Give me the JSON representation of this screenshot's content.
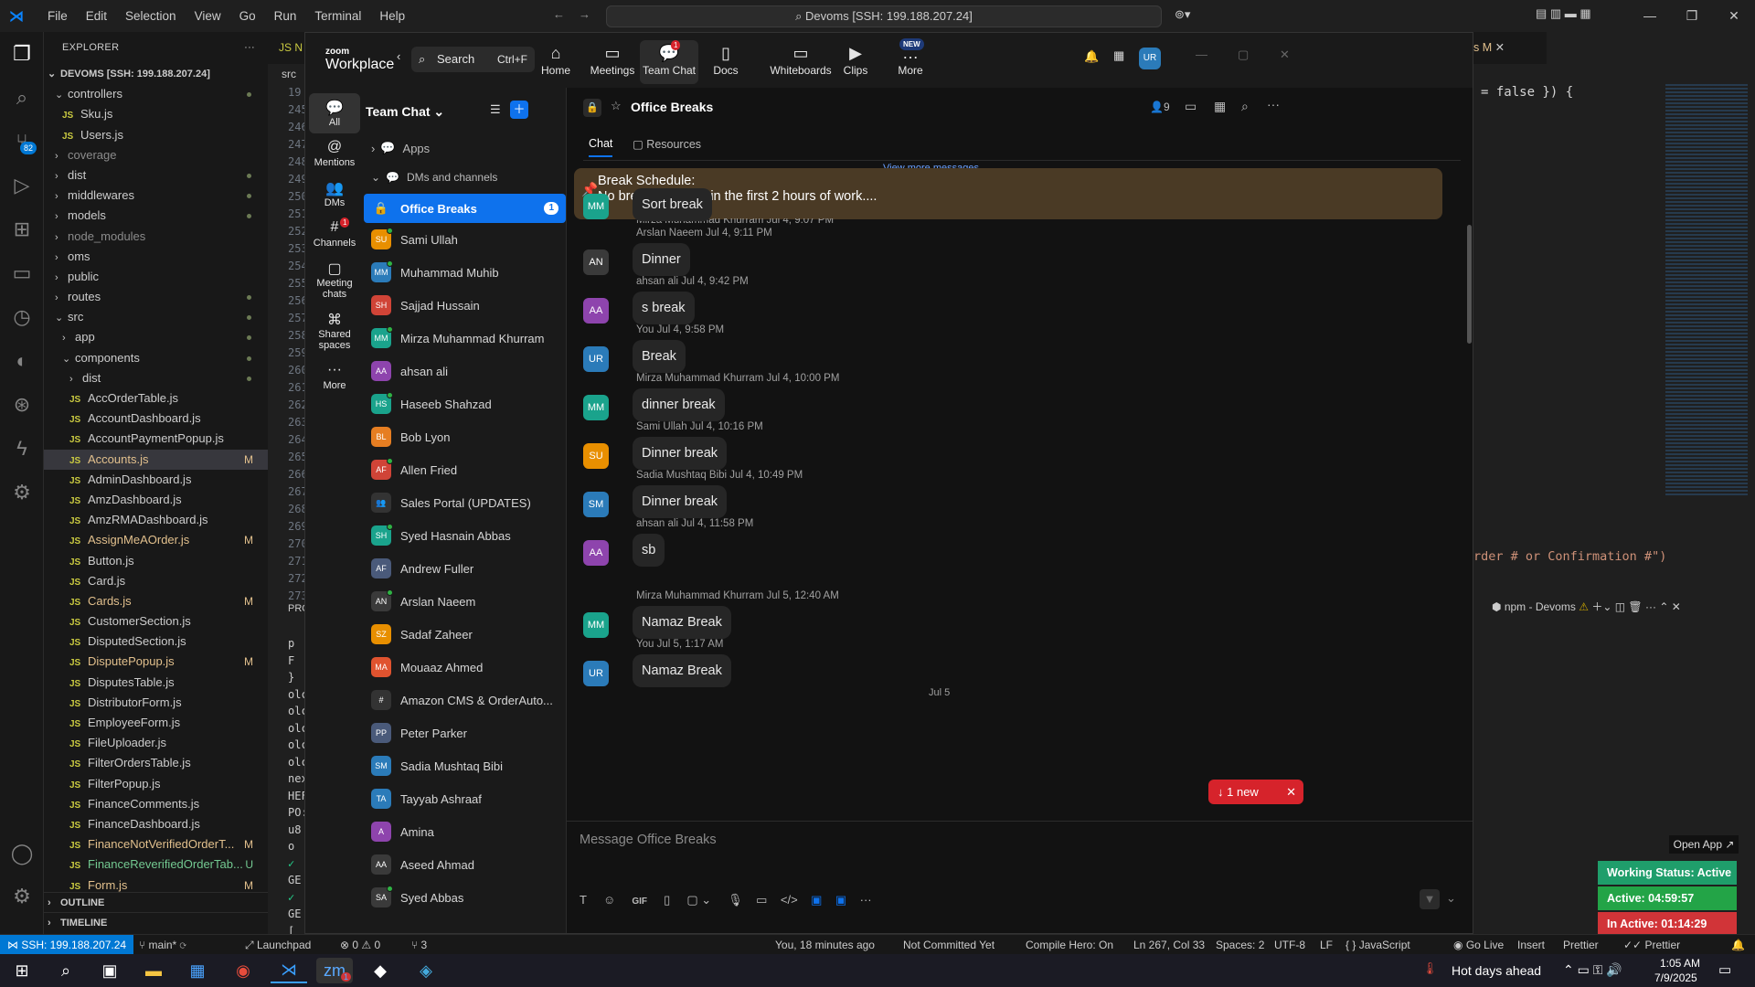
{
  "vscode": {
    "menu": [
      "File",
      "Edit",
      "Selection",
      "View",
      "Go",
      "Run",
      "Terminal",
      "Help"
    ],
    "search": "Devoms [SSH: 199.188.207.24]",
    "explorer_title": "EXPLORER",
    "root": "DEVOMS [SSH: 199.188.207.24]",
    "source_control_badge": "82",
    "tree": [
      {
        "label": "controllers",
        "type": "folder-open",
        "depth": 1,
        "dot": true
      },
      {
        "label": "Sku.js",
        "type": "js",
        "depth": 2
      },
      {
        "label": "Users.js",
        "type": "js",
        "depth": 2
      },
      {
        "label": "coverage",
        "type": "folder",
        "depth": 1,
        "dim": true
      },
      {
        "label": "dist",
        "type": "folder",
        "depth": 1,
        "dot": true
      },
      {
        "label": "middlewares",
        "type": "folder",
        "depth": 1,
        "dot": true
      },
      {
        "label": "models",
        "type": "folder",
        "depth": 1,
        "dot": true
      },
      {
        "label": "node_modules",
        "type": "folder",
        "depth": 1,
        "dim": true
      },
      {
        "label": "oms",
        "type": "folder",
        "depth": 1
      },
      {
        "label": "public",
        "type": "folder",
        "depth": 1
      },
      {
        "label": "routes",
        "type": "folder",
        "depth": 1,
        "dot": true
      },
      {
        "label": "src",
        "type": "folder-open",
        "depth": 1,
        "dot": true
      },
      {
        "label": "app",
        "type": "folder",
        "depth": 2,
        "dot": true
      },
      {
        "label": "components",
        "type": "folder-open",
        "depth": 2,
        "dot": true
      },
      {
        "label": "dist",
        "type": "folder",
        "depth": 3,
        "dot": true
      },
      {
        "label": "AccOrderTable.js",
        "type": "js",
        "depth": 3
      },
      {
        "label": "AccountDashboard.js",
        "type": "js",
        "depth": 3
      },
      {
        "label": "AccountPaymentPopup.js",
        "type": "js",
        "depth": 3
      },
      {
        "label": "Accounts.js",
        "type": "js",
        "depth": 3,
        "mark": "M",
        "selected": true
      },
      {
        "label": "AdminDashboard.js",
        "type": "js",
        "depth": 3
      },
      {
        "label": "AmzDashboard.js",
        "type": "js",
        "depth": 3
      },
      {
        "label": "AmzRMADashboard.js",
        "type": "js",
        "depth": 3
      },
      {
        "label": "AssignMeAOrder.js",
        "type": "js",
        "depth": 3,
        "mark": "M"
      },
      {
        "label": "Button.js",
        "type": "js",
        "depth": 3
      },
      {
        "label": "Card.js",
        "type": "js",
        "depth": 3
      },
      {
        "label": "Cards.js",
        "type": "js",
        "depth": 3,
        "mark": "M"
      },
      {
        "label": "CustomerSection.js",
        "type": "js",
        "depth": 3
      },
      {
        "label": "DisputedSection.js",
        "type": "js",
        "depth": 3
      },
      {
        "label": "DisputePopup.js",
        "type": "js",
        "depth": 3,
        "mark": "M"
      },
      {
        "label": "DisputesTable.js",
        "type": "js",
        "depth": 3
      },
      {
        "label": "DistributorForm.js",
        "type": "js",
        "depth": 3
      },
      {
        "label": "EmployeeForm.js",
        "type": "js",
        "depth": 3
      },
      {
        "label": "FileUploader.js",
        "type": "js",
        "depth": 3
      },
      {
        "label": "FilterOrdersTable.js",
        "type": "js",
        "depth": 3
      },
      {
        "label": "FilterPopup.js",
        "type": "js",
        "depth": 3
      },
      {
        "label": "FinanceComments.js",
        "type": "js",
        "depth": 3
      },
      {
        "label": "FinanceDashboard.js",
        "type": "js",
        "depth": 3
      },
      {
        "label": "FinanceNotVerifiedOrderT...",
        "type": "js",
        "depth": 3,
        "mark": "M"
      },
      {
        "label": "FinanceReverifiedOrderTab...",
        "type": "js",
        "depth": 3,
        "mark": "U"
      },
      {
        "label": "Form.js",
        "type": "js",
        "depth": 3,
        "mark": "M"
      }
    ],
    "outline": "OUTLINE",
    "timeline": "TIMELINE",
    "editor_tab_label": "JS N",
    "editor_crumb": "src",
    "line_numbers": [
      "19",
      "245",
      "246",
      "247",
      "248",
      "249",
      "250",
      "251",
      "252",
      "253",
      "254",
      "255",
      "256",
      "257",
      "258",
      "259",
      "260",
      "261",
      "262",
      "263",
      "264",
      "265",
      "266",
      "267",
      "268",
      "269",
      "270",
      "271",
      "272",
      "273"
    ],
    "panel_label": "PRO",
    "terminal_lines": [
      "p",
      "F",
      "}",
      "olc",
      "olc",
      "olc",
      "olc",
      "olc",
      "nex",
      "HEF",
      "PO:",
      "u8",
      "o",
      "✓",
      "GE",
      "✓",
      "GE",
      "[",
      "["
    ],
    "right_tab": "s M",
    "code_snip": "= false }) {",
    "code_snip2": "rder # or Confirmation #\")",
    "terminal_name": "npm - Devoms"
  },
  "status": {
    "ssh": "SSH: 199.188.207.24",
    "branch": "main*",
    "launchpad": "Launchpad",
    "problems": "0 ⚠ 0",
    "ports": "3",
    "blame": "You, 18 minutes ago",
    "commit": "Not Committed Yet",
    "hero": "Compile Hero: On",
    "pos": "Ln 267, Col 33",
    "spaces": "Spaces: 2",
    "enc": "UTF-8",
    "eol": "LF",
    "lang": "JavaScript",
    "golive": "Go Live",
    "insert": "Insert",
    "prettier": "Prettier",
    "prettier2": "Prettier"
  },
  "taskbar": {
    "weather": "Hot days ahead",
    "time": "1:05 AM",
    "date": "7/9/2025",
    "zoom_badge": "1"
  },
  "overlay": {
    "open_app": "Open App",
    "working": "Working Status: Active",
    "active": "Active: 04:59:57",
    "inactive": "In Active: 01:14:29",
    "colors": {
      "working": "#1f9e6b",
      "active": "#23a447",
      "inactive": "#d13438"
    }
  },
  "zoom": {
    "brand_top": "zoom",
    "brand": "Workplace",
    "search": "Search",
    "search_shortcut": "Ctrl+F",
    "nav": [
      {
        "label": "Home",
        "icon": "home-icon",
        "glyph": "⌂"
      },
      {
        "label": "Meetings",
        "icon": "video-icon",
        "glyph": "▭"
      },
      {
        "label": "Team Chat",
        "icon": "chat-icon",
        "glyph": "💬",
        "active": true,
        "badge": "1"
      },
      {
        "label": "Docs",
        "icon": "doc-icon",
        "glyph": "▯"
      },
      {
        "label": "Whiteboards",
        "icon": "whiteboard-icon",
        "glyph": "▭"
      },
      {
        "label": "Clips",
        "icon": "clips-icon",
        "glyph": "▶"
      },
      {
        "label": "More",
        "icon": "more-icon",
        "glyph": "…",
        "tag": "NEW"
      }
    ],
    "avatar": "UR",
    "left": [
      {
        "label": "All",
        "glyph": "💬",
        "active": true
      },
      {
        "label": "Mentions",
        "glyph": "@"
      },
      {
        "label": "DMs",
        "glyph": "👥"
      },
      {
        "label": "Channels",
        "glyph": "#",
        "badge": "1"
      },
      {
        "label": "Meeting chats",
        "glyph": "▢"
      },
      {
        "label": "Shared spaces",
        "glyph": "⌘"
      },
      {
        "label": "More",
        "glyph": "···"
      }
    ],
    "list_title": "Team Chat",
    "apps": "Apps",
    "dms_channels": "DMs and channels",
    "selected": "Office Breaks",
    "selected_badge": "1",
    "contacts": [
      {
        "name": "Sami Ullah",
        "initials": "SU",
        "color": "#e88f00",
        "online": true
      },
      {
        "name": "Muhammad Muhib",
        "initials": "MM",
        "color": "#2b7bb9",
        "online": true
      },
      {
        "name": "Sajjad Hussain",
        "initials": "SH",
        "color": "#d04437"
      },
      {
        "name": "Mirza Muhammad Khurram",
        "initials": "MM",
        "color": "#1aa38c",
        "online": true
      },
      {
        "name": "ahsan ali",
        "initials": "AA",
        "color": "#8e44ad"
      },
      {
        "name": "Haseeb Shahzad",
        "initials": "HS",
        "color": "#1aa38c",
        "online": true
      },
      {
        "name": "Bob Lyon",
        "initials": "BL",
        "color": "#e67e22"
      },
      {
        "name": "Allen Fried",
        "initials": "AF",
        "color": "#d04437",
        "online": true
      },
      {
        "name": "Sales Portal (UPDATES)",
        "initials": "👥",
        "color": "#333333"
      },
      {
        "name": "Syed Hasnain Abbas",
        "initials": "SH",
        "color": "#1aa38c",
        "online": true
      },
      {
        "name": "Andrew Fuller",
        "initials": "AF",
        "color": "#4a5a7a"
      },
      {
        "name": "Arslan Naeem",
        "initials": "AN",
        "color": "#3a3a3a",
        "online": true
      },
      {
        "name": "Sadaf Zaheer",
        "initials": "SZ",
        "color": "#e88f00"
      },
      {
        "name": "Mouaaz Ahmed",
        "initials": "MA",
        "color": "#e0532f"
      },
      {
        "name": "Amazon CMS & OrderAuto...",
        "initials": "#",
        "color": "#333333"
      },
      {
        "name": "Peter Parker",
        "initials": "PP",
        "color": "#4a5a7a"
      },
      {
        "name": "Sadia Mushtaq Bibi",
        "initials": "SM",
        "color": "#2b7bb9"
      },
      {
        "name": "Tayyab Ashraaf",
        "initials": "TA",
        "color": "#2b7bb9"
      },
      {
        "name": "Amina",
        "initials": "A",
        "color": "#8e44ad"
      },
      {
        "name": "Aseed Ahmad",
        "initials": "AA",
        "color": "#3a3a3a"
      },
      {
        "name": "Syed Abbas",
        "initials": "SA",
        "color": "#3a3a3a",
        "online": true
      }
    ],
    "channel": "Office Breaks",
    "members": "9",
    "tabs": [
      "Chat",
      "Resources"
    ],
    "pinned_title": "Break Schedule:",
    "pinned_body": "No breaks allowed in the first 2 hours of work....",
    "view_more": "View more messages",
    "partial_meta": "Mirza Muhammad Khurram Jul 4, 9:07 PM",
    "messages": [
      {
        "initials": "MM",
        "color": "#1aa38c",
        "meta": "",
        "text": "Sort break"
      },
      {
        "initials": "AN",
        "color": "#3a3a3a",
        "meta": "Arslan Naeem Jul 4, 9:11 PM",
        "text": "Dinner"
      },
      {
        "initials": "AA",
        "color": "#8e44ad",
        "meta": "ahsan ali Jul 4, 9:42 PM",
        "text": "s break"
      },
      {
        "initials": "UR",
        "color": "#2b7bb9",
        "meta": "You Jul 4, 9:58 PM",
        "text": "Break"
      },
      {
        "initials": "MM",
        "color": "#1aa38c",
        "meta": "Mirza Muhammad Khurram Jul 4, 10:00 PM",
        "text": "dinner break"
      },
      {
        "initials": "SU",
        "color": "#e88f00",
        "meta": "Sami Ullah Jul 4, 10:16 PM",
        "text": "Dinner break"
      },
      {
        "initials": "SM",
        "color": "#2b7bb9",
        "meta": "Sadia Mushtaq Bibi Jul 4, 10:49 PM",
        "text": "Dinner break"
      },
      {
        "initials": "AA",
        "color": "#8e44ad",
        "meta": "ahsan ali Jul 4, 11:58 PM",
        "text": "sb"
      },
      {
        "initials": "MM",
        "color": "#1aa38c",
        "meta": "Mirza Muhammad Khurram Jul 5, 12:40 AM",
        "text": "Namaz Break"
      },
      {
        "initials": "UR",
        "color": "#2b7bb9",
        "meta": "You Jul 5, 1:17 AM",
        "text": "Namaz Break"
      }
    ],
    "date_divider": "Jul 5",
    "new_pill": "1 new",
    "composer_placeholder": "Message Office Breaks"
  }
}
